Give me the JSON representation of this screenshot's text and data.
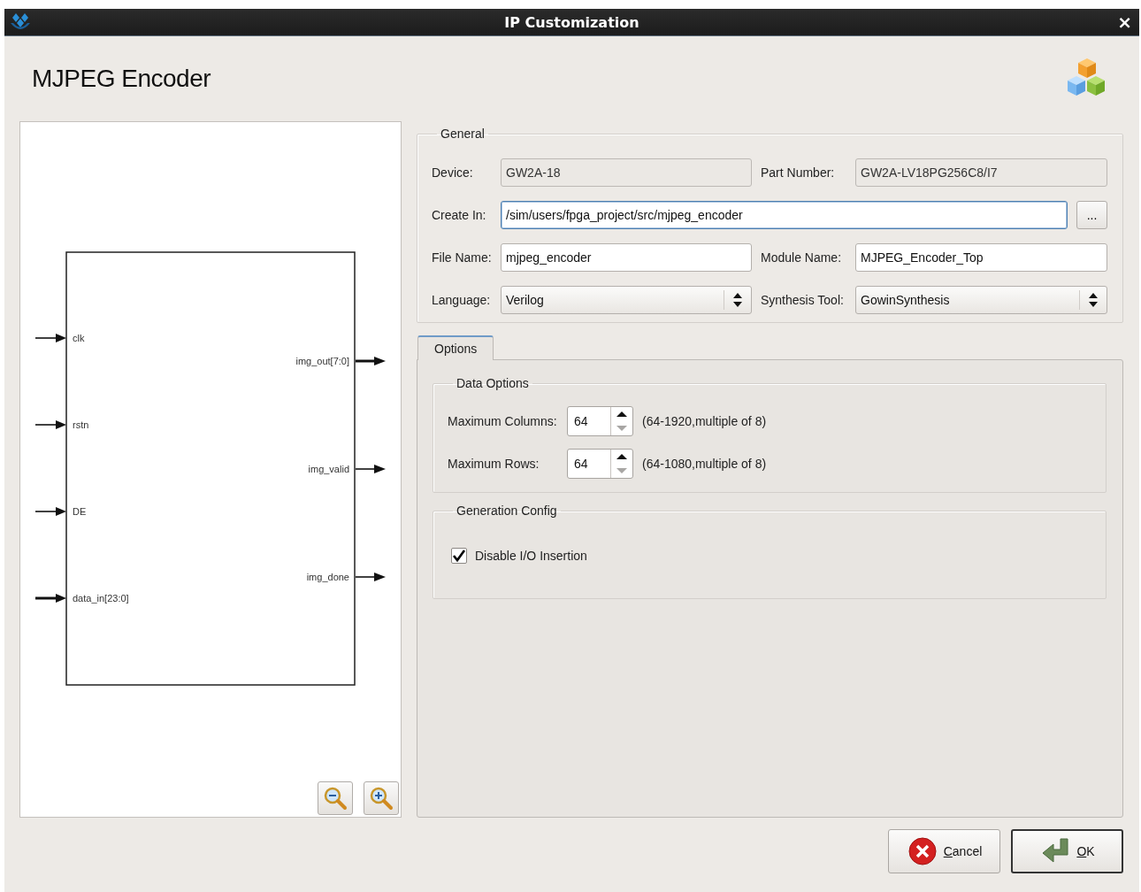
{
  "window": {
    "title": "IP Customization",
    "close": "×"
  },
  "header": {
    "title": "MJPEG Encoder"
  },
  "diagram": {
    "inputs": [
      {
        "name": "clk",
        "kind": "single"
      },
      {
        "name": "rstn",
        "kind": "single"
      },
      {
        "name": "DE",
        "kind": "single"
      },
      {
        "name": "data_in[23:0]",
        "kind": "bus"
      }
    ],
    "outputs": [
      {
        "name": "img_out[7:0]",
        "kind": "bus"
      },
      {
        "name": "img_valid",
        "kind": "single"
      },
      {
        "name": "img_done",
        "kind": "single"
      }
    ]
  },
  "general": {
    "title": "General",
    "rows": [
      {
        "fields": [
          {
            "label": "Device:",
            "kind": "readonly",
            "value": "GW2A-18"
          },
          {
            "label": "Part Number:",
            "kind": "readonly",
            "value": "GW2A-LV18PG256C8/I7"
          }
        ]
      },
      {
        "fields": [
          {
            "label": "Create In:",
            "kind": "path",
            "value": "/sim/users/fpga_project/src/mjpeg_encoder",
            "focused": true,
            "button": "..."
          }
        ]
      },
      {
        "fields": [
          {
            "label": "File Name:",
            "kind": "text",
            "value": "mjpeg_encoder"
          },
          {
            "label": "Module Name:",
            "kind": "text",
            "value": "MJPEG_Encoder_Top"
          }
        ]
      },
      {
        "fields": [
          {
            "label": "Language:",
            "kind": "select",
            "value": "Verilog"
          },
          {
            "label": "Synthesis Tool:",
            "kind": "select",
            "value": "GowinSynthesis"
          }
        ]
      }
    ]
  },
  "options": {
    "tabs": [
      {
        "label": "Options",
        "selected": true
      }
    ],
    "groups": [
      {
        "title": "Data Options",
        "items": [
          {
            "kind": "spinner",
            "label": "Maximum Columns:",
            "value": "64",
            "hint": "(64-1920,multiple of 8)",
            "at_minimum": true
          },
          {
            "kind": "spinner",
            "label": "Maximum Rows:",
            "value": "64",
            "hint": "(64-1080,multiple of 8)",
            "at_minimum": true
          }
        ]
      },
      {
        "title": "Generation Config",
        "items": [
          {
            "kind": "checkbox",
            "label": "Disable I/O Insertion",
            "checked": true
          }
        ]
      }
    ]
  },
  "buttons": [
    {
      "label": "Cancel",
      "kind": "cancel",
      "default": false
    },
    {
      "label": "OK",
      "kind": "ok",
      "default": true
    }
  ]
}
